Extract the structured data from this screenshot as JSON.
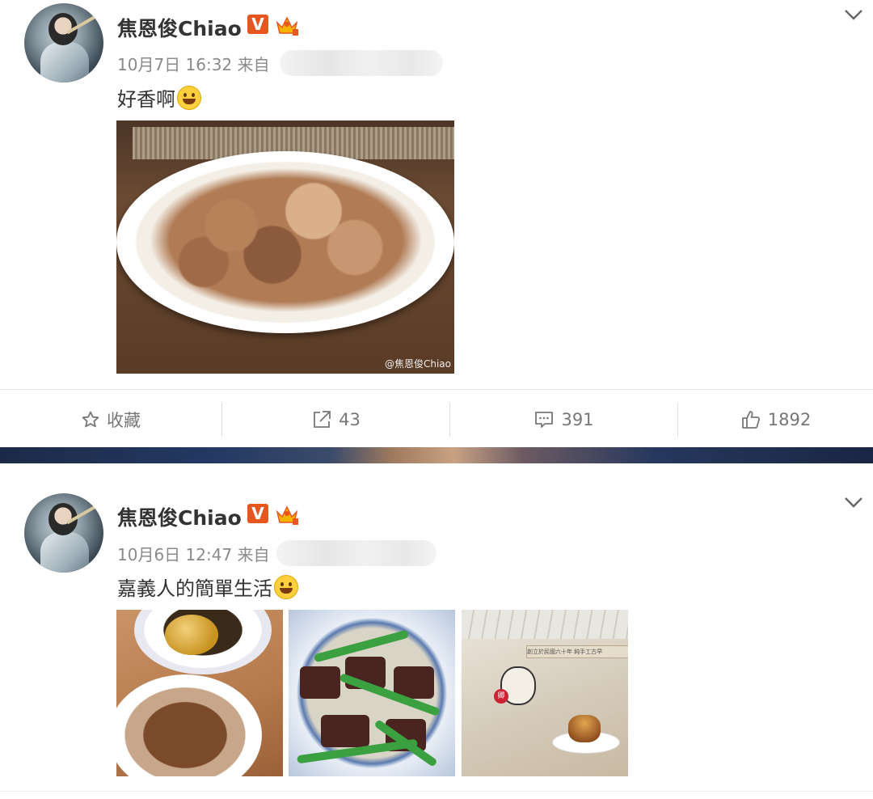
{
  "posts": [
    {
      "author": "焦恩俊Chiao",
      "verified_badge": "V",
      "time": "10月7日 16:32",
      "source_prefix": "来自",
      "text": "好香啊",
      "image_watermark": "@焦恩俊Chiao",
      "actions": {
        "favorite": "收藏",
        "repost": "43",
        "comment": "391",
        "like": "1892"
      }
    },
    {
      "author": "焦恩俊Chiao",
      "verified_badge": "V",
      "time": "10月6日 12:47",
      "source_prefix": "来自",
      "text": "嘉義人的簡單生活",
      "thumb3_sign": "創立於民國六十年 純手工古早",
      "thumb3_stamp": "卿"
    }
  ],
  "colors": {
    "badge_orange": "#e8561f",
    "meta_gray": "#8a8a8a",
    "action_gray": "#777777"
  },
  "icons": [
    "chevron-down-icon",
    "crown-icon",
    "star-icon",
    "share-icon",
    "comment-icon",
    "thumbs-up-icon",
    "emoji-grin-icon",
    "emoji-smile-icon"
  ]
}
